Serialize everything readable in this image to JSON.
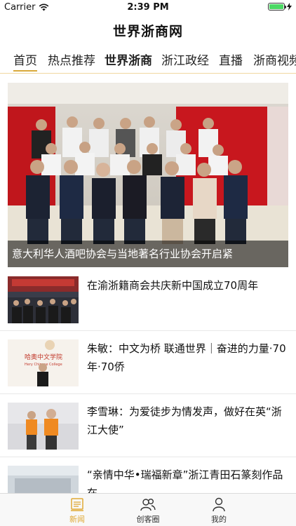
{
  "status_bar": {
    "carrier": "Carrier",
    "time": "2:39 PM",
    "battery_level": 1.0,
    "battery_color": "#4cd964"
  },
  "header": {
    "title": "世界浙商网"
  },
  "tabs": [
    {
      "label": "首页",
      "selected": true
    },
    {
      "label": "热点推荐",
      "selected": false
    },
    {
      "label": "世界浙商",
      "selected": false
    },
    {
      "label": "浙江政经",
      "selected": false
    },
    {
      "label": "直播",
      "selected": false
    },
    {
      "label": "浙商视频",
      "selected": false
    }
  ],
  "hero": {
    "caption": "意大利华人酒吧协会与当地著名行业协会开启紧"
  },
  "news": [
    {
      "title": "在渝浙籍商会共庆新中国成立70周年"
    },
    {
      "title": "朱敏：中文为桥 联通世界｜奋进的力量·70年·70侨",
      "thumb_text": "哈奥中文学院",
      "thumb_subtext": "Hery Chinese College"
    },
    {
      "title": "李雪琳：为爱徒步为情发声，做好在英“浙江大使”"
    },
    {
      "title": "“亲情中华•瑞福新章”浙江青田石篆刻作品在"
    }
  ],
  "bottom_nav": [
    {
      "label": "新闻",
      "icon": "news-icon",
      "active": true
    },
    {
      "label": "创客圈",
      "icon": "community-icon",
      "active": false
    },
    {
      "label": "我的",
      "icon": "profile-icon",
      "active": false
    }
  ],
  "colors": {
    "accent": "#d9a93a",
    "active_nav": "#e0a935",
    "inactive_nav": "#333333"
  }
}
